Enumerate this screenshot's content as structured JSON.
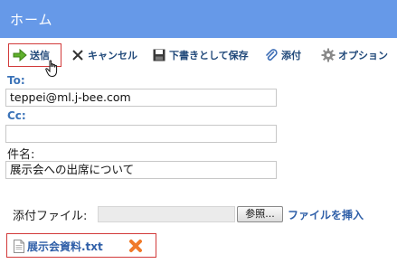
{
  "header": {
    "title": "ホーム"
  },
  "toolbar": {
    "send": {
      "label": "送信",
      "icon": "arrow-right-icon"
    },
    "cancel": {
      "label": "キャンセル",
      "icon": "close-icon"
    },
    "save_draft": {
      "label": "下書きとして保存",
      "icon": "save-icon"
    },
    "attach": {
      "label": "添付",
      "icon": "paperclip-icon"
    },
    "options": {
      "label": "オプション",
      "icon": "gear-icon"
    }
  },
  "form": {
    "to": {
      "label": "To:",
      "value": "teppei@ml.j-bee.com"
    },
    "cc": {
      "label": "Cc:",
      "value": ""
    },
    "subject": {
      "label": "件名:",
      "value": "展示会への出席について"
    }
  },
  "attachment": {
    "label": "添付ファイル:",
    "browse_label": "参照...",
    "insert_label": "ファイルを挿入",
    "files": [
      {
        "name": "展示会資料.txt",
        "icon": "text-file-icon",
        "delete_icon": "delete-icon"
      }
    ]
  },
  "colors": {
    "header": "#6699e8",
    "link": "#2f5fa8",
    "highlight_border": "#d23a3a"
  }
}
